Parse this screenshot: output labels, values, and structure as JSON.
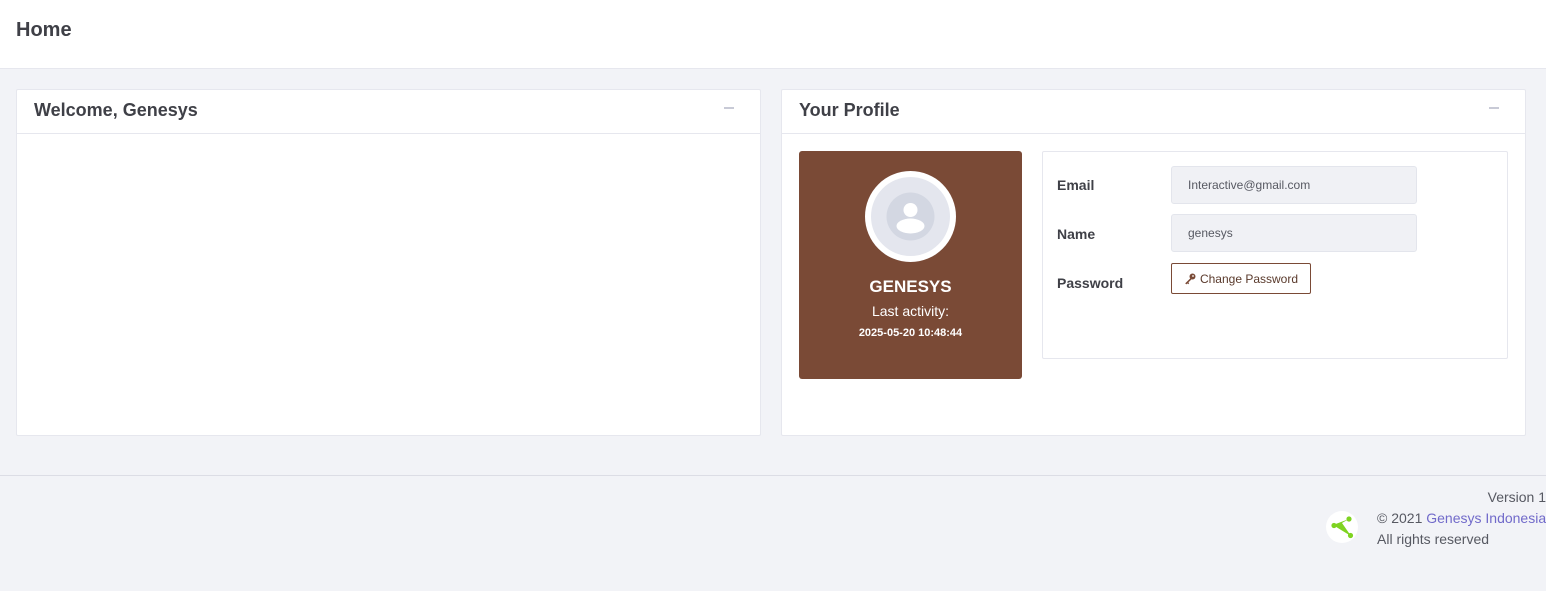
{
  "header": {
    "title": "Home"
  },
  "welcome_card": {
    "title": "Welcome, Genesys"
  },
  "profile_card": {
    "title": "Your Profile",
    "user": {
      "display_name": "GENESYS",
      "last_activity_label": "Last activity:",
      "last_activity_value": "2025-05-20 10:48:44"
    },
    "fields": {
      "email_label": "Email",
      "email_value": "Interactive@gmail.com",
      "name_label": "Name",
      "name_value": "genesys",
      "password_label": "Password",
      "change_password_label": "Change Password"
    }
  },
  "footer": {
    "version": "Version 1",
    "copyright_prefix": "© 2021",
    "company_link": "Genesys Indonesia",
    "rights": "All rights reserved"
  },
  "icons": {
    "collapse": "minus-icon",
    "avatar": "user-avatar-icon",
    "key": "key-icon",
    "logo": "genesys-logo-icon"
  },
  "colors": {
    "avatar_panel": "#7a4a36",
    "page_background": "#f2f3f7",
    "link": "#716aca",
    "logo_accent": "#7ed321"
  }
}
